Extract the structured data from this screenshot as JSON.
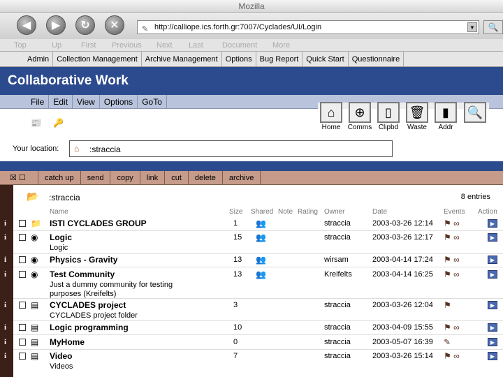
{
  "window": {
    "title": "Mozilla"
  },
  "browser": {
    "url": "http://calliope.ics.forth.gr:7007/Cyclades/UI/Login",
    "linkbar": [
      "Top",
      "Up",
      "First",
      "Previous",
      "Next",
      "Last",
      "Document",
      "More"
    ]
  },
  "adminbar": [
    "Admin",
    "Collection Management",
    "Archive Management",
    "Options",
    "Bug Report",
    "Quick Start",
    "Questionnaire"
  ],
  "app": {
    "title": "Collaborative Work",
    "menu": [
      "File",
      "Edit",
      "View",
      "Options",
      "GoTo"
    ],
    "tools": [
      "Home",
      "Comms",
      "Clipbd",
      "Waste",
      "Addr"
    ],
    "location_label": "Your location:",
    "location_value": ":straccia"
  },
  "actions": [
    "catch up",
    "send",
    "copy",
    "link",
    "cut",
    "delete",
    "archive"
  ],
  "folder": {
    "name": ":straccia",
    "entries": "8 entries"
  },
  "columns": [
    "Name",
    "Size",
    "Shared",
    "Note",
    "Rating",
    "Owner",
    "Date",
    "Events",
    "Action"
  ],
  "rows": [
    {
      "name": "ISTI CYCLADES GROUP",
      "desc": "",
      "size": "1",
      "owner": "straccia",
      "date": "2003-03-26 12:14"
    },
    {
      "name": "Logic",
      "desc": "Logic",
      "size": "15",
      "owner": "straccia",
      "date": "2003-03-26 12:17"
    },
    {
      "name": "Physics - Gravity",
      "desc": "",
      "size": "13",
      "owner": "wirsam",
      "date": "2003-04-14 17:24"
    },
    {
      "name": "Test Community",
      "desc": "Just a dummy community for testing",
      "desc2": "purposes (Kreifelts)",
      "size": "13",
      "owner": "Kreifelts",
      "date": "2003-04-14 16:25"
    },
    {
      "name": "CYCLADES project",
      "desc": "CYCLADES project folder",
      "size": "3",
      "owner": "straccia",
      "date": "2003-03-26 12:04"
    },
    {
      "name": "Logic programming",
      "desc": "",
      "size": "10",
      "owner": "straccia",
      "date": "2003-04-09 15:55"
    },
    {
      "name": "MyHome",
      "desc": "",
      "size": "0",
      "owner": "straccia",
      "date": "2003-05-07 16:39"
    },
    {
      "name": "Video",
      "desc": "Videos",
      "size": "7",
      "owner": "straccia",
      "date": "2003-03-26 15:14"
    }
  ]
}
